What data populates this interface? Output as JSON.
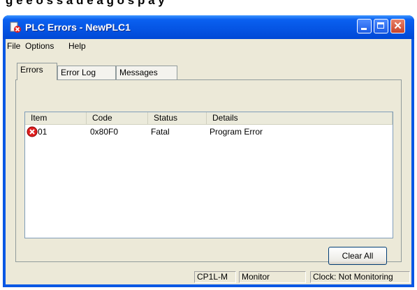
{
  "window": {
    "title": "PLC Errors - NewPLC1"
  },
  "menu": {
    "items": [
      "File",
      "Options",
      "Help"
    ]
  },
  "tabs": [
    "Errors",
    "Error Log",
    "Messages"
  ],
  "table": {
    "headers": [
      "Item",
      "Code",
      "Status",
      "Details"
    ],
    "rows": [
      {
        "item": "01",
        "code": "0x80F0",
        "status": "Fatal",
        "details": "Program Error"
      }
    ]
  },
  "buttons": {
    "clear_all": "Clear All"
  },
  "status": {
    "model": "CP1L-M",
    "mode": "Monitor",
    "clock": "Clock: Not Monitoring"
  },
  "colors": {
    "titlebar": "#0a58e4",
    "error": "#e02020"
  }
}
